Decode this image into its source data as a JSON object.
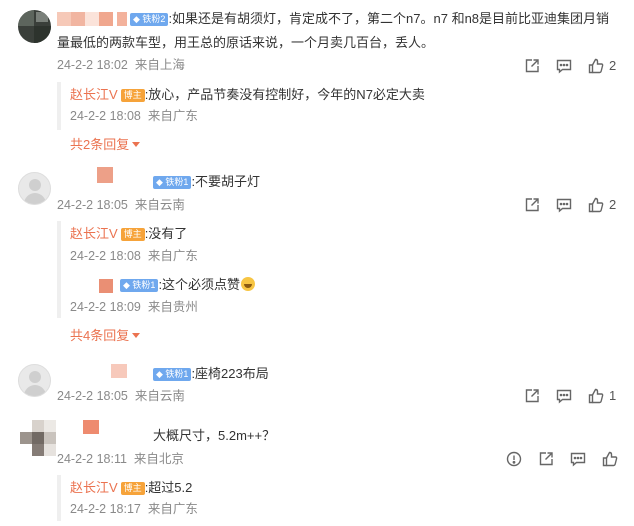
{
  "comments": [
    {
      "level": "铁粉2",
      "text_line1": ":如果还是有胡须灯，肯定成不了，第二个n7。n7 和n8是目前比亚迪集团月销",
      "text_line2": "量最低的两款车型，用王总的原话来说，一个月卖几百台，丢人。",
      "time": "24-2-2 18:02",
      "location": "来自上海",
      "like_count": "2",
      "replies": [
        {
          "author": "赵长江V",
          "badge": "博主",
          "text": ":放心，产品节奏没有控制好，今年的N7必定大卖",
          "time": "24-2-2 18:08",
          "location": "来自广东"
        }
      ],
      "more_replies": "共2条回复"
    },
    {
      "level": "铁粉1",
      "text": ":不要胡子灯",
      "time": "24-2-2 18:05",
      "location": "来自云南",
      "like_count": "2",
      "replies": [
        {
          "author": "赵长江V",
          "badge": "博主",
          "text": ":没有了",
          "time": "24-2-2 18:08",
          "location": "来自广东"
        },
        {
          "level": "铁粉1",
          "text": ":这个必须点赞",
          "time": "24-2-2 18:09",
          "location": "来自贵州"
        }
      ],
      "more_replies": "共4条回复"
    },
    {
      "level": "铁粉1",
      "text": ":座椅223布局",
      "time": "24-2-2 18:05",
      "location": "来自云南",
      "like_count": "1"
    },
    {
      "text": "大概尺寸，5.2m++？",
      "time": "24-2-2 18:11",
      "location": "来自北京",
      "replies": [
        {
          "author": "赵长江V",
          "badge": "博主",
          "text": ":超过5.2",
          "time": "24-2-2 18:17",
          "location": "来自广东"
        }
      ]
    }
  ],
  "icons": {
    "share": "share-icon",
    "comment": "comment-icon",
    "like": "like-icon",
    "report": "report-icon"
  },
  "colors": {
    "accent": "#eb7350",
    "meta_text": "#8a8a8a",
    "level_badge": "#6fa8ee",
    "blogger_badge": "#f6a33a"
  }
}
